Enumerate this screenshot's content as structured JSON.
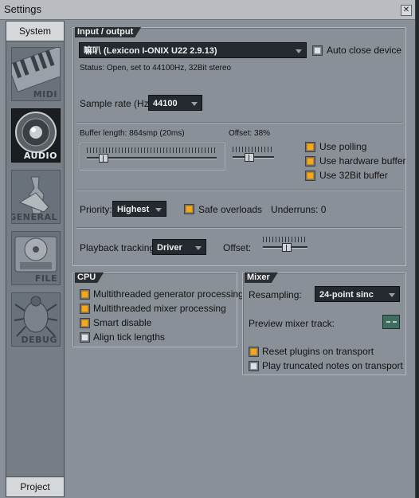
{
  "window": {
    "title": "Settings"
  },
  "left_nav": {
    "top_tab": "System",
    "bottom_tab": "Project",
    "items": [
      {
        "label": "MIDI",
        "icon": "piano-keyboard-icon"
      },
      {
        "label": "AUDIO",
        "icon": "speaker-icon"
      },
      {
        "label": "GENERAL",
        "icon": "wrench-icon"
      },
      {
        "label": "FILE",
        "icon": "floppy-disk-icon"
      },
      {
        "label": "DEBUG",
        "icon": "beetle-icon"
      }
    ],
    "active": "AUDIO"
  },
  "io": {
    "section": "Input / output",
    "device": "嘛叭 (Lexicon I-ONIX U22 2.9.13)",
    "auto_close_label": "Auto close device",
    "status": "Status:  Open, set to 44100Hz, 32Bit stereo",
    "sample_rate_label": "Sample rate (Hz):",
    "sample_rate": "44100",
    "buffer_label": "Buffer length: 864smp (20ms)",
    "buffer_fraction": 0.1,
    "offset_label": "Offset: 38%",
    "offset_fraction": 0.38,
    "use_polling": "Use polling",
    "use_hardware_buffer": "Use hardware buffer",
    "use_32bit_buffer": "Use 32Bit buffer",
    "priority_label": "Priority:",
    "priority": "Highest",
    "safe_overloads": "Safe overloads",
    "underruns": "Underruns: 0",
    "playback_tracking_label": "Playback tracking:",
    "playback_tracking": "Driver",
    "playback_offset_label": "Offset:"
  },
  "cpu": {
    "section": "CPU",
    "multithreaded_generator": "Multithreaded generator processing",
    "multithreaded_mixer": "Multithreaded mixer processing",
    "smart_disable": "Smart disable",
    "align_tick": "Align tick lengths"
  },
  "mixer": {
    "section": "Mixer",
    "resampling_label": "Resampling:",
    "resampling": "24-point sinc",
    "preview_label": "Preview mixer track:",
    "reset_plugins": "Reset plugins on transport",
    "play_truncated": "Play truncated notes on transport"
  },
  "colors": {
    "accent": "#f3a91b",
    "panel": "#8a9097",
    "dropdown": "#242a2f"
  }
}
